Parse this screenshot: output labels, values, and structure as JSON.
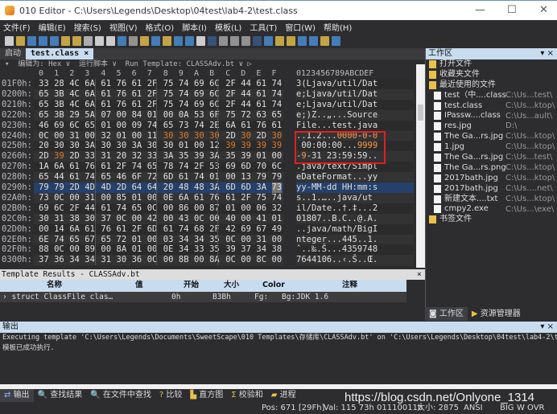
{
  "window": {
    "title": "010 Editor - C:\\Users\\Legends\\Desktop\\04test\\lab4-2\\test.class",
    "minimize": "—",
    "maximize": "☐",
    "close": "✕"
  },
  "menu": [
    "文件(F)",
    "编辑(E)",
    "搜索(S)",
    "视图(V)",
    "格式(O)",
    "脚本(I)",
    "模板(L)",
    "工具(T)",
    "窗口(W)",
    "帮助(H)"
  ],
  "tabs": [
    {
      "label": "启动"
    },
    {
      "label": "test.class ×",
      "active": true
    }
  ],
  "editbar": "▾  编辑为: Hex ∨  运行脚本 ∨  Run Template: CLASSAdv.bt ∨ ▷",
  "hex_columns": [
    "0",
    "1",
    "2",
    "3",
    "4",
    "5",
    "6",
    "7",
    "8",
    "9",
    "A",
    "B",
    "C",
    "D",
    "E",
    "F"
  ],
  "ascii_header": "0123456789ABCDEF",
  "hex_rows": [
    {
      "addr": "01F0h:",
      "bytes": "33 28 4C 6A 61 76 61 2F 75 74 69 6C 2F 44 61 74",
      "ascii": "3(Ljava/util/Dat"
    },
    {
      "addr": "0200h:",
      "bytes": "65 3B 4C 6A 61 76 61 2F 75 74 69 6C 2F 44 61 74",
      "ascii": "e;Ljava/util/Dat"
    },
    {
      "addr": "0210h:",
      "bytes": "65 3B 4C 6A 61 76 61 2F 75 74 69 6C 2F 44 61 74",
      "ascii": "e;Ljava/util/Dat"
    },
    {
      "addr": "0220h:",
      "bytes": "65 3B 29 5A 07 00 84 01 00 0A 53 6F 75 72 63 65",
      "ascii": "e;)Z..„...Source"
    },
    {
      "addr": "0230h:",
      "bytes": "46 69 6C 65 01 00 09 74 65 73 74 2E 6A 61 76 61",
      "ascii": "File...test.java"
    },
    {
      "addr": "0240h:",
      "bytes": "0C 00 31 00 32 01 00 11 30 30 30 30 2D 30 2D 30",
      "ascii": "..1.2...0000-0-0",
      "orange": [
        8,
        9,
        10,
        11,
        13,
        15
      ]
    },
    {
      "addr": "0250h:",
      "bytes": "20 30 30 3A 30 30 3A 30 30 01 00 12 39 39 39 39",
      "ascii": " 00:00:00...9999",
      "orange": [
        12,
        13,
        14,
        15
      ]
    },
    {
      "addr": "0260h:",
      "bytes": "2D 39 2D 33 31 20 32 33 3A 35 39 3A 35 39 01 00",
      "ascii": "-9-31 23:59:59..",
      "orange": [
        1
      ]
    },
    {
      "addr": "0270h:",
      "bytes": "1A 6A 61 76 61 2F 74 65 78 74 2F 53 69 6D 70 6C",
      "ascii": ".java/text/Simpl"
    },
    {
      "addr": "0280h:",
      "bytes": "65 44 61 74 65 46 6F 72 6D 61 74 01 00 13 79 79",
      "ascii": "eDateFormat...yy"
    },
    {
      "addr": "0290h:",
      "bytes": "79 79 2D 4D 4D 2D 64 64 20 48 48 3A 6D 6D 3A 73",
      "ascii": "yy-MM-dd HH:mm:s",
      "selected": true,
      "cursor": 15
    },
    {
      "addr": "02A0h:",
      "bytes": "73 0C 00 31 00 85 01 00 0E 6A 61 76 61 2F 75 74",
      "ascii": "s..1.…..java/ut"
    },
    {
      "addr": "02B0h:",
      "bytes": "69 6C 2F 44 61 74 65 0C 00 86 00 87 01 00 06 32",
      "ascii": "il/Date..†.‡...2"
    },
    {
      "addr": "02C0h:",
      "bytes": "30 31 38 30 37 0C 00 42 00 43 0C 00 40 00 41 01",
      "ascii": "01807..B.C..@.A."
    },
    {
      "addr": "02D0h:",
      "bytes": "00 14 6A 61 76 61 2F 6D 61 74 68 2F 42 69 67 49",
      "ascii": "..java/math/BigI"
    },
    {
      "addr": "02E0h:",
      "bytes": "6E 74 65 67 65 72 01 00 03 34 34 35 0C 00 31 00",
      "ascii": "nteger...445..1."
    },
    {
      "addr": "02F0h:",
      "bytes": "88 0C 00 89 00 8A 01 00 0E 34 33 35 39 37 34 38",
      "ascii": "ˆ..‰.Š...4359748"
    },
    {
      "addr": "0300h:",
      "bytes": "37 36 34 34 31 30 36 0C 00 8B 00 8A 0C 00 8C 00",
      "ascii": "7644106..‹.Š..Œ."
    }
  ],
  "colors": {
    "highlight": "#e07a2a",
    "selection": "#25406a",
    "panel_header": "#c8dcf0",
    "annotation_box": "#e02020"
  },
  "workspace": {
    "title": "工作区",
    "controls": "▾ ×",
    "items": [
      {
        "label": "打开文件",
        "type": "folder"
      },
      {
        "label": "收藏夹文件",
        "type": "folder"
      },
      {
        "label": "最近使用的文件",
        "type": "folder-open"
      },
      {
        "label": "test（中....class",
        "path": "C:\\Us...test\\",
        "type": "file"
      },
      {
        "label": "test.class",
        "path": "C:\\Us...ktop\\",
        "type": "file"
      },
      {
        "label": "IPassw....class",
        "path": "C:\\Us...ault\\",
        "type": "file"
      },
      {
        "label": "res.jpg",
        "path": "D:\\",
        "type": "file"
      },
      {
        "label": "The Ga...rs.jpg",
        "path": "C:\\Us...ktop\\",
        "type": "file"
      },
      {
        "label": "1.jpg",
        "path": "C:\\Us...ktop\\",
        "type": "file"
      },
      {
        "label": "The Ga...rs.jpg",
        "path": "C:\\Us...test\\",
        "type": "file"
      },
      {
        "label": "The Ga...rs.png",
        "path": "C:\\Us...ktop\\",
        "type": "file"
      },
      {
        "label": "2017bath.jpg",
        "path": "C:\\Us...ktop\\",
        "type": "file"
      },
      {
        "label": "2017bath.jpg",
        "path": "C:\\Us....net\\",
        "type": "file"
      },
      {
        "label": "新建文本....txt",
        "path": "C:\\Us...ktop\\",
        "type": "file"
      },
      {
        "label": "cmpy2.exe",
        "path": "C:\\Us...\\exe\\",
        "type": "file"
      },
      {
        "label": "书签文件",
        "type": "folder"
      }
    ],
    "tabs": [
      "工作区",
      "资源管理器"
    ]
  },
  "template": {
    "title": "Template Results - CLASSAdv.bt",
    "close": "×",
    "columns": [
      "名称",
      "值",
      "开始",
      "大小",
      "Color",
      "注释"
    ],
    "row": {
      "name": "› struct ClassFile clas…",
      "value": "",
      "start": "0h",
      "size": "B3Bh",
      "fg": "Fg:",
      "bg": "Bg:",
      "comment": "JDK 1.6"
    }
  },
  "output": {
    "title": "输出",
    "controls": "▾ ×",
    "lines": [
      "Executing template 'C:\\Users\\Legends\\Documents\\SweetScape\\010 Templates\\存储库\\CLASSAdv.bt' on 'C:\\Users\\Legends\\Desktop\\04test\\lab4-2\\test.class'...",
      "模板已成功执行."
    ]
  },
  "bottom_tabs": [
    "输出",
    "查找结果",
    "在文件中查找",
    "比较",
    "直方图",
    "校验和",
    "进程"
  ],
  "status": {
    "pos": "Pos: 671 [29Fh]",
    "val": "Val: 115 73h 01110011b",
    "size": "大小: 2875",
    "enc": "ANSI",
    "big": "BIG",
    "w": "W",
    "ovr": "OVR"
  },
  "watermark": "https://blog.csdn.net/Onlyone_1314"
}
